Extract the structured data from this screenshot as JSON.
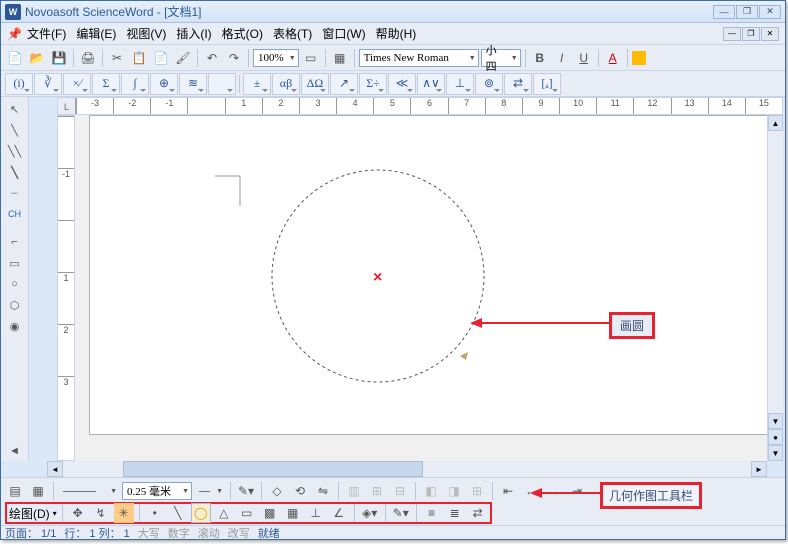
{
  "app": {
    "title": "Novoasoft ScienceWord - [文档1]",
    "icon": "W"
  },
  "menu": {
    "items": [
      "文件(F)",
      "编辑(E)",
      "视图(V)",
      "插入(I)",
      "格式(O)",
      "表格(T)",
      "窗口(W)",
      "帮助(H)"
    ]
  },
  "toolbar1": {
    "zoom": "100%",
    "font": "Times New Roman",
    "size": "小四"
  },
  "bottom1": {
    "linewidth": "0.25 毫米"
  },
  "bottom2": {
    "draw_label": "绘图(D)"
  },
  "status": {
    "page": "页面： 1/1",
    "rowcol": "行： 1 列： 1",
    "caps": "大写",
    "num": "数字",
    "scroll": "滚动",
    "ovr": "改写",
    "ready": "就绪"
  },
  "callouts": {
    "circle": "画圆",
    "toolbar": "几何作图工具栏"
  },
  "ruler": {
    "h": [
      "-3",
      "-2",
      "-1",
      "",
      "1",
      "2",
      "3",
      "4",
      "5",
      "6",
      "7",
      "8",
      "9",
      "10",
      "11",
      "12",
      "13",
      "14",
      "15"
    ],
    "v": [
      "",
      "-1",
      "",
      "1",
      "2",
      "3"
    ]
  },
  "math_buttons": [
    "(i)",
    "∛",
    "×∕",
    "Σ",
    "∫",
    "⊕",
    "≋",
    "",
    "±",
    "αβ",
    "ΔΩ",
    "↗",
    "Σ÷",
    "≪",
    "∧∨",
    "⊥",
    "⊚",
    "⇄",
    "[ₐ]"
  ]
}
